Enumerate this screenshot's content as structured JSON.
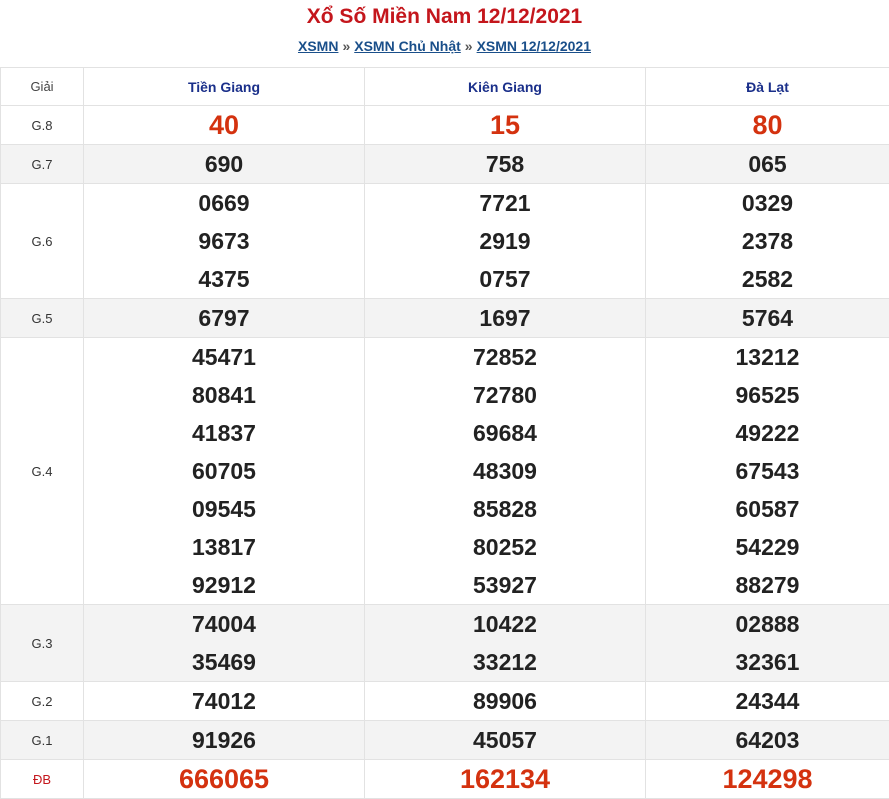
{
  "header": {
    "title": "Xổ Số Miền Nam 12/12/2021",
    "breadcrumb": [
      {
        "label": "XSMN"
      },
      {
        "label": "XSMN Chủ Nhật"
      },
      {
        "label": "XSMN 12/12/2021"
      }
    ],
    "separator": "»"
  },
  "table": {
    "header_label": "Giải",
    "provinces": [
      "Tiền Giang",
      "Kiên Giang",
      "Đà Lạt"
    ],
    "rows": [
      {
        "label": "G.8",
        "values": [
          [
            "40"
          ],
          [
            "15"
          ],
          [
            "80"
          ]
        ]
      },
      {
        "label": "G.7",
        "values": [
          [
            "690"
          ],
          [
            "758"
          ],
          [
            "065"
          ]
        ]
      },
      {
        "label": "G.6",
        "values": [
          [
            "0669",
            "9673",
            "4375"
          ],
          [
            "7721",
            "2919",
            "0757"
          ],
          [
            "0329",
            "2378",
            "2582"
          ]
        ]
      },
      {
        "label": "G.5",
        "values": [
          [
            "6797"
          ],
          [
            "1697"
          ],
          [
            "5764"
          ]
        ]
      },
      {
        "label": "G.4",
        "values": [
          [
            "45471",
            "80841",
            "41837",
            "60705",
            "09545",
            "13817",
            "92912"
          ],
          [
            "72852",
            "72780",
            "69684",
            "48309",
            "85828",
            "80252",
            "53927"
          ],
          [
            "13212",
            "96525",
            "49222",
            "67543",
            "60587",
            "54229",
            "88279"
          ]
        ]
      },
      {
        "label": "G.3",
        "values": [
          [
            "74004",
            "35469"
          ],
          [
            "10422",
            "33212"
          ],
          [
            "02888",
            "32361"
          ]
        ]
      },
      {
        "label": "G.2",
        "values": [
          [
            "74012"
          ],
          [
            "89906"
          ],
          [
            "24344"
          ]
        ]
      },
      {
        "label": "G.1",
        "values": [
          [
            "91926"
          ],
          [
            "45057"
          ],
          [
            "64203"
          ]
        ]
      },
      {
        "label": "ĐB",
        "values": [
          [
            "666065"
          ],
          [
            "162134"
          ],
          [
            "124298"
          ]
        ]
      }
    ]
  },
  "colors": {
    "title": "#c4161c",
    "link": "#1a4f8a",
    "province": "#1a2f8a",
    "highlight": "#d4320f"
  }
}
